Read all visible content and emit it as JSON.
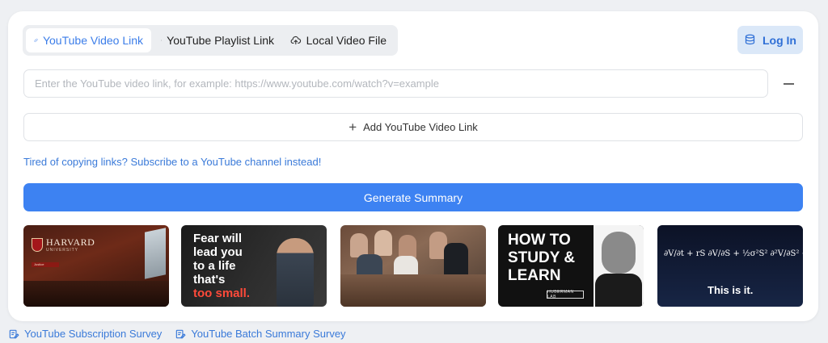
{
  "tabs": [
    {
      "label": "YouTube Video Link",
      "icon": "link-icon",
      "active": true
    },
    {
      "label": "YouTube Playlist Link",
      "icon": "link-icon",
      "active": false
    },
    {
      "label": "Local Video File",
      "icon": "cloud-upload-icon",
      "active": false
    }
  ],
  "header": {
    "login_label": "Log In",
    "login_icon": "database-icon"
  },
  "input": {
    "value": "",
    "placeholder": "Enter the YouTube video link, for example: https://www.youtube.com/watch?v=example"
  },
  "actions": {
    "add_label": "Add YouTube Video Link",
    "subscribe_link": "Tired of copying links? Subscribe to a YouTube channel instead!",
    "generate_label": "Generate Summary"
  },
  "thumbnails": {
    "t1": {
      "brand": "HARVARD",
      "sub": "UNIVERSITY",
      "tag": "Justice"
    },
    "t2": {
      "line1": "Fear will",
      "line2": "lead you",
      "line3": "to a life",
      "line4": "that's",
      "line5": "too small."
    },
    "t4": {
      "line1": "HOW TO",
      "line2": "STUDY &",
      "line3": "LEARN",
      "logo": "HUBERMAN LAB"
    },
    "t5": {
      "caption": "This is it."
    }
  },
  "surveys": [
    {
      "label": "YouTube Subscription Survey",
      "icon": "edit-note-icon"
    },
    {
      "label": "YouTube Batch Summary Survey",
      "icon": "edit-note-icon"
    }
  ],
  "colors": {
    "accent": "#3d82f2",
    "link": "#3a7ad9",
    "login_bg": "#dbe8f8"
  }
}
